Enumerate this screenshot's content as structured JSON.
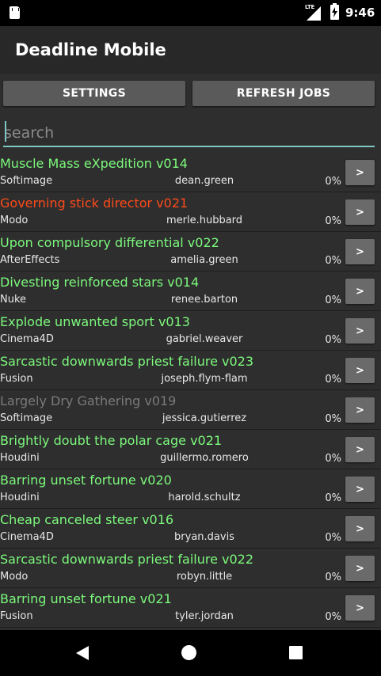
{
  "status_bar": {
    "network_label": "LTE",
    "time": "9:46",
    "icons": [
      "sd-card-icon",
      "signal-icon",
      "battery-charging-icon"
    ]
  },
  "app_bar": {
    "title": "Deadline Mobile"
  },
  "toolbar": {
    "settings_label": "SETTINGS",
    "refresh_label": "REFRESH JOBS"
  },
  "search": {
    "value": "",
    "placeholder": "search"
  },
  "colors": {
    "active": "#7cf97c",
    "failed": "#ff4a1a",
    "suspended": "#7a7a7a",
    "accent": "#7fc7c2"
  },
  "jobs": [
    {
      "name": "Muscle Mass eXpedition v014",
      "plugin": "Softimage",
      "user": "dean.green",
      "progress": "0%",
      "status": "active",
      "action": ">"
    },
    {
      "name": "Governing stick director v021",
      "plugin": "Modo",
      "user": "merle.hubbard",
      "progress": "0%",
      "status": "failed",
      "action": ">"
    },
    {
      "name": "Upon compulsory differential v022",
      "plugin": "AfterEffects",
      "user": "amelia.green",
      "progress": "0%",
      "status": "active",
      "action": ">"
    },
    {
      "name": "Divesting reinforced stars v014",
      "plugin": "Nuke",
      "user": "renee.barton",
      "progress": "0%",
      "status": "active",
      "action": ">"
    },
    {
      "name": "Explode unwanted sport v013",
      "plugin": "Cinema4D",
      "user": "gabriel.weaver",
      "progress": "0%",
      "status": "active",
      "action": ">"
    },
    {
      "name": "Sarcastic downwards priest failure v023",
      "plugin": "Fusion",
      "user": "joseph.flym-flam",
      "progress": "0%",
      "status": "active",
      "action": ">"
    },
    {
      "name": "Largely Dry Gathering v019",
      "plugin": "Softimage",
      "user": "jessica.gutierrez",
      "progress": "0%",
      "status": "suspended",
      "action": ">"
    },
    {
      "name": "Brightly doubt the polar cage v021",
      "plugin": "Houdini",
      "user": "guillermo.romero",
      "progress": "0%",
      "status": "active",
      "action": ">"
    },
    {
      "name": "Barring unset fortune v020",
      "plugin": "Houdini",
      "user": "harold.schultz",
      "progress": "0%",
      "status": "active",
      "action": ">"
    },
    {
      "name": "Cheap canceled steer v016",
      "plugin": "Cinema4D",
      "user": "bryan.davis",
      "progress": "0%",
      "status": "active",
      "action": ">"
    },
    {
      "name": "Sarcastic downwards priest failure v022",
      "plugin": "Modo",
      "user": "robyn.little",
      "progress": "0%",
      "status": "active",
      "action": ">"
    },
    {
      "name": "Barring unset fortune v021",
      "plugin": "Fusion",
      "user": "tyler.jordan",
      "progress": "0%",
      "status": "active",
      "action": ">"
    }
  ],
  "nav_bar": {
    "icons": [
      "back-icon",
      "home-icon",
      "recents-icon"
    ]
  }
}
